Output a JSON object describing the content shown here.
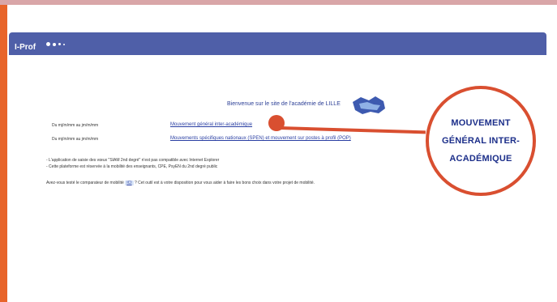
{
  "header": {
    "brand": "I-Prof"
  },
  "portal": {
    "welcome": "Bienvenue sur le site de l'académie de LILLE",
    "rows": [
      {
        "date": "Du mj/m/mm au jm/m/mm",
        "link": "Mouvement général inter-académique"
      },
      {
        "date": "Du mj/m/mm au jm/m/mm",
        "link": "Mouvements spécifiques nationaux (SPEN) et mouvement sur postes à profil (POP)"
      }
    ],
    "notes": [
      "- L'application de saisie des vœux \"SIAM 2nd degré\" n'est pas compatible avec Internet Explorer",
      "- Cette plateforme est réservée à la mobilité des enseignants, CPE, PsyEN du 2nd degré public"
    ],
    "compare_prefix": "Avez-vous testé le comparateur de mobilité",
    "compare_link": "ICI",
    "compare_suffix": "? Cet outil est à votre disposition pour vous aider à faire les bons choix dans votre projet de mobilité."
  },
  "callout": {
    "text": "MOUVEMENT\nGÉNÉRAL INTER-\nACADÉMIQUE"
  },
  "colors": {
    "accent_orange": "#e8642a",
    "header_blue": "#4f5fa8",
    "callout_red": "#d94f30",
    "link_blue": "#2a3fa3"
  }
}
